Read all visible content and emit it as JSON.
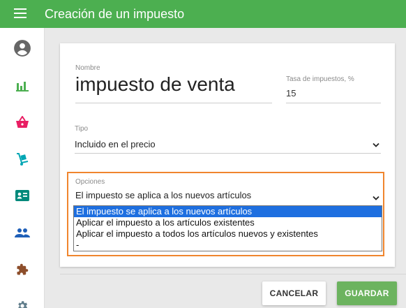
{
  "header": {
    "title": "Creación de un impuesto",
    "menu_icon": "hamburger-menu-icon"
  },
  "sidebar": {
    "items": [
      {
        "icon": "account-circle-icon"
      },
      {
        "icon": "bar-chart-icon"
      },
      {
        "icon": "shopping-basket-icon"
      },
      {
        "icon": "hand-truck-icon"
      },
      {
        "icon": "id-card-icon"
      },
      {
        "icon": "people-icon"
      },
      {
        "icon": "puzzle-icon"
      },
      {
        "icon": "settings-gear-icon"
      }
    ]
  },
  "form": {
    "name_label": "Nombre",
    "name_value": "impuesto de venta",
    "tax_label": "Tasa de impuestos, %",
    "tax_value": "15",
    "type_label": "Tipo",
    "type_value": "Incluido en el precio",
    "options_label": "Opciones",
    "options_value": "El impuesto se aplica a los nuevos artículos",
    "options_list": [
      "El impuesto se aplica a los nuevos artículos",
      "Aplicar el impuesto a los artículos existentes",
      "Aplicar el impuesto a todos los artículos nuevos y existentes",
      "-"
    ]
  },
  "buttons": {
    "cancel": "CANCELAR",
    "save": "GUARDAR"
  },
  "colors": {
    "primary": "#4caf50",
    "highlight": "#f0852d",
    "selection": "#1e6fe0"
  }
}
